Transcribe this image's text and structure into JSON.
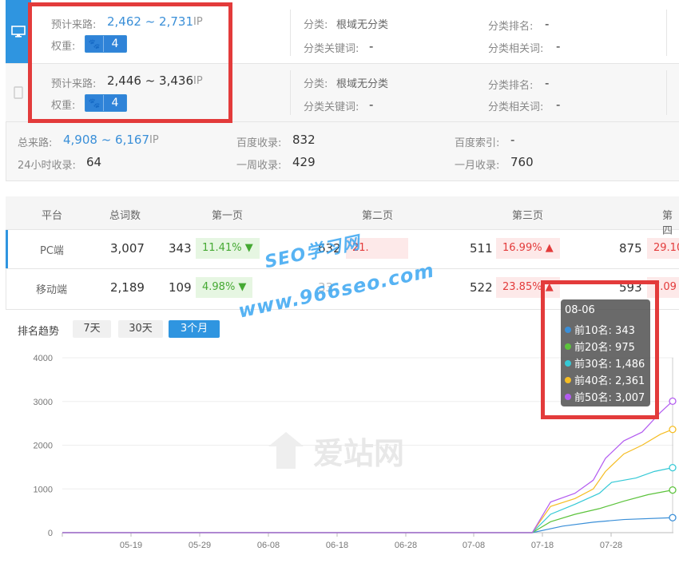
{
  "rows": [
    {
      "est_label": "预计来路:",
      "est_range": "2,462 ~ 2,731",
      "unit": "IP",
      "weight_label": "权重:",
      "weight": "4",
      "cat_label": "分类:",
      "cat_value": "根域无分类",
      "catkw_label": "分类关键词:",
      "catkw_value": "-",
      "rank_label": "分类排名:",
      "rank_value": "-",
      "rel_label": "分类相关词:",
      "rel_value": "-"
    },
    {
      "est_label": "预计来路:",
      "est_range": "2,446 ~ 3,436",
      "unit": "IP",
      "weight_label": "权重:",
      "weight": "4",
      "cat_label": "分类:",
      "cat_value": "根域无分类",
      "catkw_label": "分类关键词:",
      "catkw_value": "-",
      "rank_label": "分类排名:",
      "rank_value": "-",
      "rel_label": "分类相关词:",
      "rel_value": "-"
    }
  ],
  "summary": {
    "total_label": "总来路:",
    "total_value": "4,908 ~ 6,167",
    "total_unit": "IP",
    "baidu_label": "百度收录:",
    "baidu_value": "832",
    "index_label": "百度索引:",
    "index_value": "-",
    "h24_label": "24小时收录:",
    "h24_value": "64",
    "week_label": "一周收录:",
    "week_value": "429",
    "month_label": "一月收录:",
    "month_value": "760"
  },
  "table": {
    "headers": [
      "平台",
      "总词数",
      "第一页",
      "第二页",
      "第三页",
      "第四"
    ],
    "rows": [
      {
        "platform": "PC端",
        "total": "3,007",
        "p1": "343",
        "p1pct": "11.41% ▼",
        "p2": "632",
        "p2pct": "21.",
        "p3": "511",
        "p3pct": "16.99% ▲",
        "p4": "875",
        "p4pct": "29.10"
      },
      {
        "platform": "移动端",
        "total": "2,189",
        "p1": "109",
        "p1pct": "4.98% ▼",
        "p2": "33",
        "p2pct": "",
        "p3": "522",
        "p3pct": "23.85% ▲",
        "p4": "593",
        "p4pct": "7.09"
      }
    ]
  },
  "trend": {
    "label": "排名趋势",
    "buttons": [
      "7天",
      "30天",
      "3个月"
    ],
    "active": "3个月"
  },
  "tooltip": {
    "date": "08-06",
    "items": [
      {
        "label": "前10名: 343",
        "color": "#3a8fd8"
      },
      {
        "label": "前20名: 975",
        "color": "#5cc33c"
      },
      {
        "label": "前30名: 1,486",
        "color": "#35c9d6"
      },
      {
        "label": "前40名: 2,361",
        "color": "#f5bd23"
      },
      {
        "label": "前50名: 3,007",
        "color": "#b35cf0"
      }
    ]
  },
  "chart_data": {
    "type": "line",
    "x_ticks": [
      "05-19",
      "05-29",
      "06-08",
      "06-18",
      "06-28",
      "07-08",
      "07-18",
      "07-28"
    ],
    "y_ticks": [
      "0",
      "1000",
      "2000",
      "3000",
      "4000"
    ],
    "ylim": [
      0,
      4000
    ],
    "series": [
      {
        "name": "前10名",
        "color": "#3a8fd8",
        "points": [
          [
            0,
            0
          ],
          [
            0.77,
            0
          ],
          [
            0.82,
            150
          ],
          [
            0.87,
            240
          ],
          [
            0.92,
            300
          ],
          [
            1.0,
            343
          ]
        ]
      },
      {
        "name": "前20名",
        "color": "#5cc33c",
        "points": [
          [
            0,
            0
          ],
          [
            0.77,
            0
          ],
          [
            0.8,
            250
          ],
          [
            0.84,
            420
          ],
          [
            0.88,
            550
          ],
          [
            0.92,
            720
          ],
          [
            0.96,
            870
          ],
          [
            1.0,
            975
          ]
        ]
      },
      {
        "name": "前30名",
        "color": "#35c9d6",
        "points": [
          [
            0,
            0
          ],
          [
            0.77,
            0
          ],
          [
            0.8,
            420
          ],
          [
            0.84,
            650
          ],
          [
            0.88,
            900
          ],
          [
            0.9,
            1150
          ],
          [
            0.94,
            1250
          ],
          [
            0.97,
            1400
          ],
          [
            1.0,
            1486
          ]
        ]
      },
      {
        "name": "前40名",
        "color": "#f5bd23",
        "points": [
          [
            0,
            0
          ],
          [
            0.77,
            0
          ],
          [
            0.8,
            600
          ],
          [
            0.84,
            780
          ],
          [
            0.87,
            1000
          ],
          [
            0.89,
            1400
          ],
          [
            0.92,
            1800
          ],
          [
            0.95,
            2000
          ],
          [
            0.98,
            2250
          ],
          [
            1.0,
            2361
          ]
        ]
      },
      {
        "name": "前50名",
        "color": "#b35cf0",
        "points": [
          [
            0,
            0
          ],
          [
            0.77,
            0
          ],
          [
            0.8,
            700
          ],
          [
            0.84,
            900
          ],
          [
            0.87,
            1200
          ],
          [
            0.89,
            1700
          ],
          [
            0.92,
            2100
          ],
          [
            0.95,
            2300
          ],
          [
            0.98,
            2750
          ],
          [
            1.0,
            3007
          ]
        ]
      }
    ]
  },
  "watermarks": {
    "line1": "SEO学习网",
    "line2": "www.966seo.com",
    "logo": "爱站网"
  }
}
